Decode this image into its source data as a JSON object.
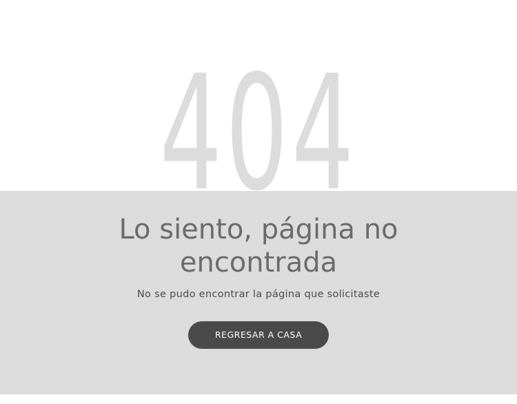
{
  "error": {
    "code": "404",
    "title": "Lo siento, página no encontrada",
    "message": "No se pudo encontrar la página que solicitaste"
  },
  "actions": {
    "home_button_label": "REGRESAR A CASA"
  },
  "colors": {
    "background": "#ffffff",
    "panel": "#dcdcdc",
    "code": "#dcdcdc",
    "title": "#6b6b6b",
    "subtitle": "#4a4a4a",
    "button": "#4a4a4a",
    "button_text": "#ffffff"
  }
}
